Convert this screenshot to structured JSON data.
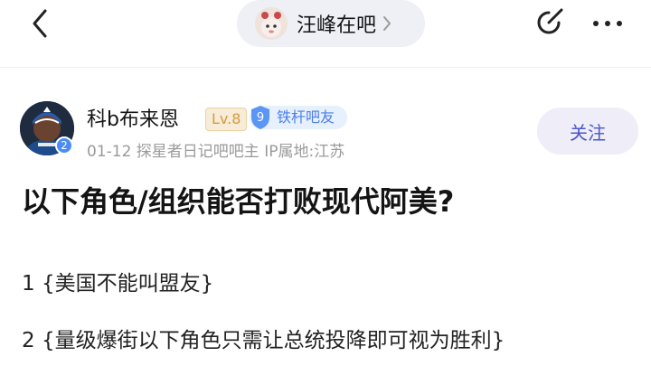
{
  "header": {
    "forum_name": "汪峰在吧",
    "back_icon": "chevron-left-icon",
    "edit_icon": "edit-icon",
    "more_icon": "more-dots-icon"
  },
  "author": {
    "name": "科b布来恩",
    "level": "Lv.8",
    "avatar_badge": "2",
    "fan_badge_number": "9",
    "fan_badge_label": "铁杆吧友",
    "meta": "01-12  探星者日记吧吧主  IP属地:江苏",
    "follow_label": "关注"
  },
  "post": {
    "title": "以下角色/组织能否打败现代阿美?",
    "lines": [
      "1 {美国不能叫盟友}",
      "2 {量级爆街以下角色只需让总统投降即可视为胜利}"
    ]
  },
  "colors": {
    "accent": "#4a57c8",
    "level_gold": "#d49b3a",
    "badge_blue": "#4a7ef0"
  }
}
